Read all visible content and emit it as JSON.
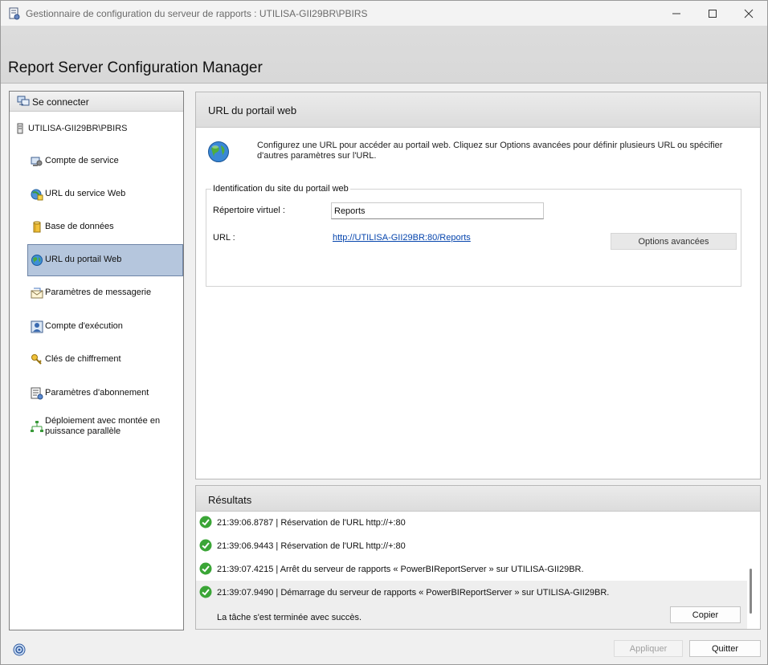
{
  "window": {
    "title": "Gestionnaire de configuration du serveur de rapports : UTILISA-GII29BR\\PBIRS"
  },
  "header": {
    "title": "Report Server Configuration Manager"
  },
  "sidebar": {
    "connect_label": "Se connecter",
    "server_label": "UTILISA-GII29BR\\PBIRS",
    "items": [
      {
        "label": "Compte de service",
        "icon": "service-account-icon"
      },
      {
        "label": "URL du service Web",
        "icon": "web-service-url-icon"
      },
      {
        "label": "Base de données",
        "icon": "database-icon"
      },
      {
        "label": "URL du portail Web",
        "icon": "globe-icon",
        "selected": true
      },
      {
        "label": "Paramètres de messagerie",
        "icon": "email-icon"
      },
      {
        "label": "Compte d'exécution",
        "icon": "execution-account-icon"
      },
      {
        "label": "Clés de chiffrement",
        "icon": "keys-icon"
      },
      {
        "label": "Paramètres d'abonnement",
        "icon": "subscription-icon"
      },
      {
        "label": "Déploiement avec montée en puissance parallèle",
        "icon": "scale-out-icon"
      }
    ]
  },
  "main": {
    "section_title": "URL du portail web",
    "intro": "Configurez une URL pour accéder au portail web. Cliquez sur Options avancées pour définir plusieurs URL ou spécifier d'autres paramètres sur l'URL.",
    "group_title": "Identification du site du portail web",
    "virtual_dir_label": "Répertoire virtuel :",
    "virtual_dir_value": "Reports",
    "url_label": "URL :",
    "url_value": "http://UTILISA-GII29BR:80/Reports",
    "advanced_button": "Options avancées"
  },
  "results": {
    "title": "Résultats",
    "rows": [
      {
        "text": "21:39:06.8787 | Réservation de l'URL http://+:80"
      },
      {
        "text": "21:39:06.9443 | Réservation de l'URL http://+:80"
      },
      {
        "text": "21:39:07.4215 | Arrêt du serveur de rapports « PowerBIReportServer » sur UTILISA-GII29BR."
      },
      {
        "text": "21:39:07.9490 | Démarrage du serveur de rapports « PowerBIReportServer » sur UTILISA-GII29BR."
      }
    ],
    "status": "La tâche s'est terminée avec succès.",
    "copy_button": "Copier"
  },
  "footer": {
    "apply_button": "Appliquer",
    "quit_button": "Quitter"
  },
  "colors": {
    "selected_bg": "#b5c6dd",
    "link": "#0645ad",
    "success": "#3aa536"
  }
}
